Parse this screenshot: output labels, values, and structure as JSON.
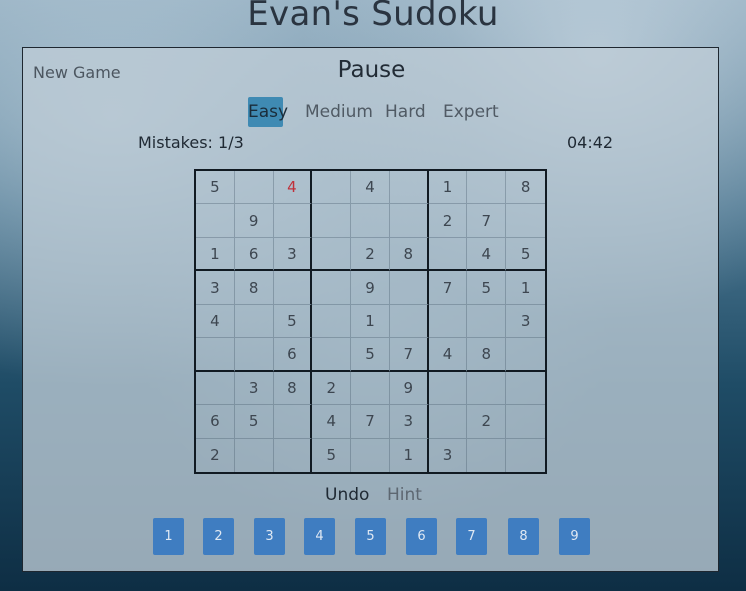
{
  "app": {
    "title": "Evan's Sudoku"
  },
  "controls": {
    "new_game": "New Game",
    "pause": "Pause"
  },
  "difficulty": {
    "options": [
      "Easy",
      "Medium",
      "Hard",
      "Expert"
    ],
    "selected": "Easy"
  },
  "status": {
    "mistakes": "Mistakes: 1/3",
    "timer": "04:42"
  },
  "board": {
    "rows": [
      [
        "5",
        "",
        "4",
        "",
        "4",
        "",
        "1",
        "",
        "8"
      ],
      [
        "",
        "9",
        "",
        "",
        "",
        "",
        "2",
        "7",
        ""
      ],
      [
        "1",
        "6",
        "3",
        "",
        "2",
        "8",
        "",
        "4",
        "5"
      ],
      [
        "3",
        "8",
        "",
        "",
        "9",
        "",
        "7",
        "5",
        "1"
      ],
      [
        "4",
        "",
        "5",
        "",
        "1",
        "",
        "",
        "",
        "3"
      ],
      [
        "",
        "",
        "6",
        "",
        "5",
        "7",
        "4",
        "8",
        ""
      ],
      [
        "",
        "3",
        "8",
        "2",
        "",
        "9",
        "",
        "",
        ""
      ],
      [
        "6",
        "5",
        "",
        "4",
        "7",
        "3",
        "",
        "2",
        ""
      ],
      [
        "2",
        "",
        "",
        "5",
        "",
        "1",
        "3",
        "",
        ""
      ]
    ],
    "error_cells": [
      [
        0,
        2
      ]
    ],
    "error_color": "#c0303a"
  },
  "actions": {
    "undo": "Undo",
    "hint": "Hint"
  },
  "numpad": [
    "1",
    "2",
    "3",
    "4",
    "5",
    "6",
    "7",
    "8",
    "9"
  ],
  "colors": {
    "accent": "#3f8ab3",
    "numpad": "#3f7dc1"
  }
}
